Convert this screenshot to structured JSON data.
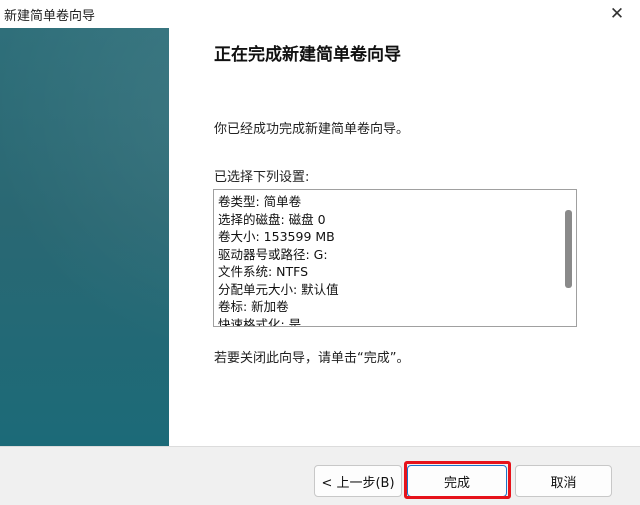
{
  "window": {
    "title": "新建简单卷向导",
    "close_glyph": "✕"
  },
  "main": {
    "heading": "正在完成新建简单卷向导",
    "success_text": "你已经成功完成新建简单卷向导。",
    "settings_label": "已选择下列设置:",
    "settings_lines": [
      "卷类型: 简单卷",
      "选择的磁盘: 磁盘 0",
      "卷大小: 153599 MB",
      "驱动器号或路径: G:",
      "文件系统: NTFS",
      "分配单元大小: 默认值",
      "卷标: 新加卷",
      "快速格式化: 是"
    ],
    "close_hint": "若要关闭此向导，请单击“完成”。"
  },
  "buttons": {
    "back": "< 上一步(B)",
    "finish": "完成",
    "cancel": "取消"
  },
  "colors": {
    "sidebar": "#2a6873",
    "highlight": "#e6121a"
  }
}
